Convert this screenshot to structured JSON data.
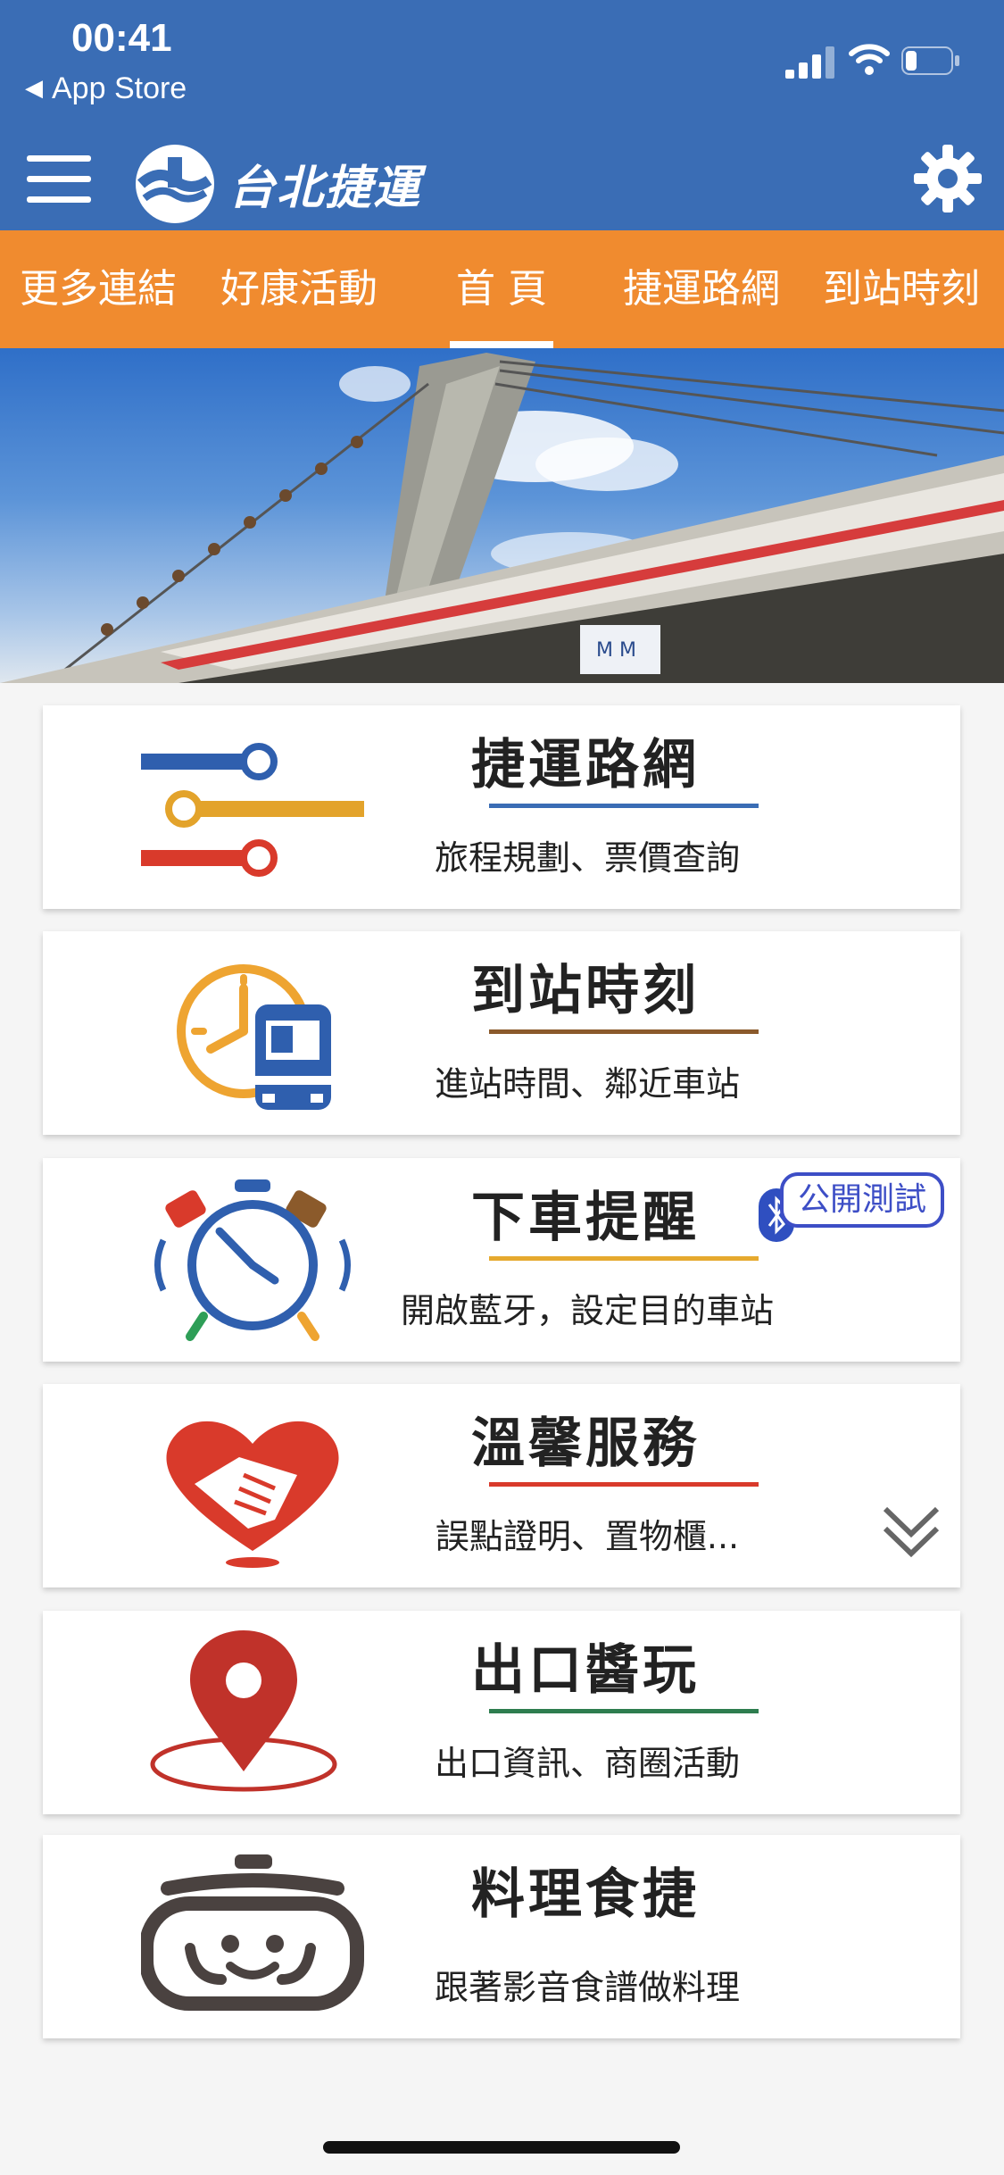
{
  "status_bar": {
    "time": "00:41",
    "back_app": "App Store"
  },
  "header": {
    "logo_text": "台北捷運",
    "menu_icon": "hamburger-menu-icon",
    "settings_icon": "gear-icon"
  },
  "tabs": [
    {
      "label": "更多連結",
      "active": false
    },
    {
      "label": "好康活動",
      "active": false
    },
    {
      "label": "首 頁",
      "active": true
    },
    {
      "label": "捷運路網",
      "active": false
    },
    {
      "label": "到站時刻",
      "active": false
    }
  ],
  "cards": [
    {
      "title": "捷運路網",
      "subtitle": "旅程規劃、票價查詢",
      "underline_color": "#3a6db5",
      "icon": "metro-lines-icon"
    },
    {
      "title": "到站時刻",
      "subtitle": "進站時間、鄰近車站",
      "underline_color": "#8b5a2b",
      "icon": "clock-train-icon"
    },
    {
      "title": "下車提醒",
      "subtitle": "開啟藍牙，設定目的車站",
      "underline_color": "#e6a92e",
      "icon": "alarm-clock-icon",
      "badge": "公開測試"
    },
    {
      "title": "溫馨服務",
      "subtitle": "誤點證明、置物櫃...",
      "underline_color": "#d93a2b",
      "icon": "heart-handshake-icon"
    },
    {
      "title": "出口醬玩",
      "subtitle": "出口資訊、商圈活動",
      "underline_color": "#2e7d4f",
      "icon": "location-pin-icon"
    },
    {
      "title": "料理食捷",
      "subtitle": "跟著影音食譜做料理",
      "underline_color": "#ffffff",
      "icon": "cooking-pot-face-icon"
    }
  ]
}
